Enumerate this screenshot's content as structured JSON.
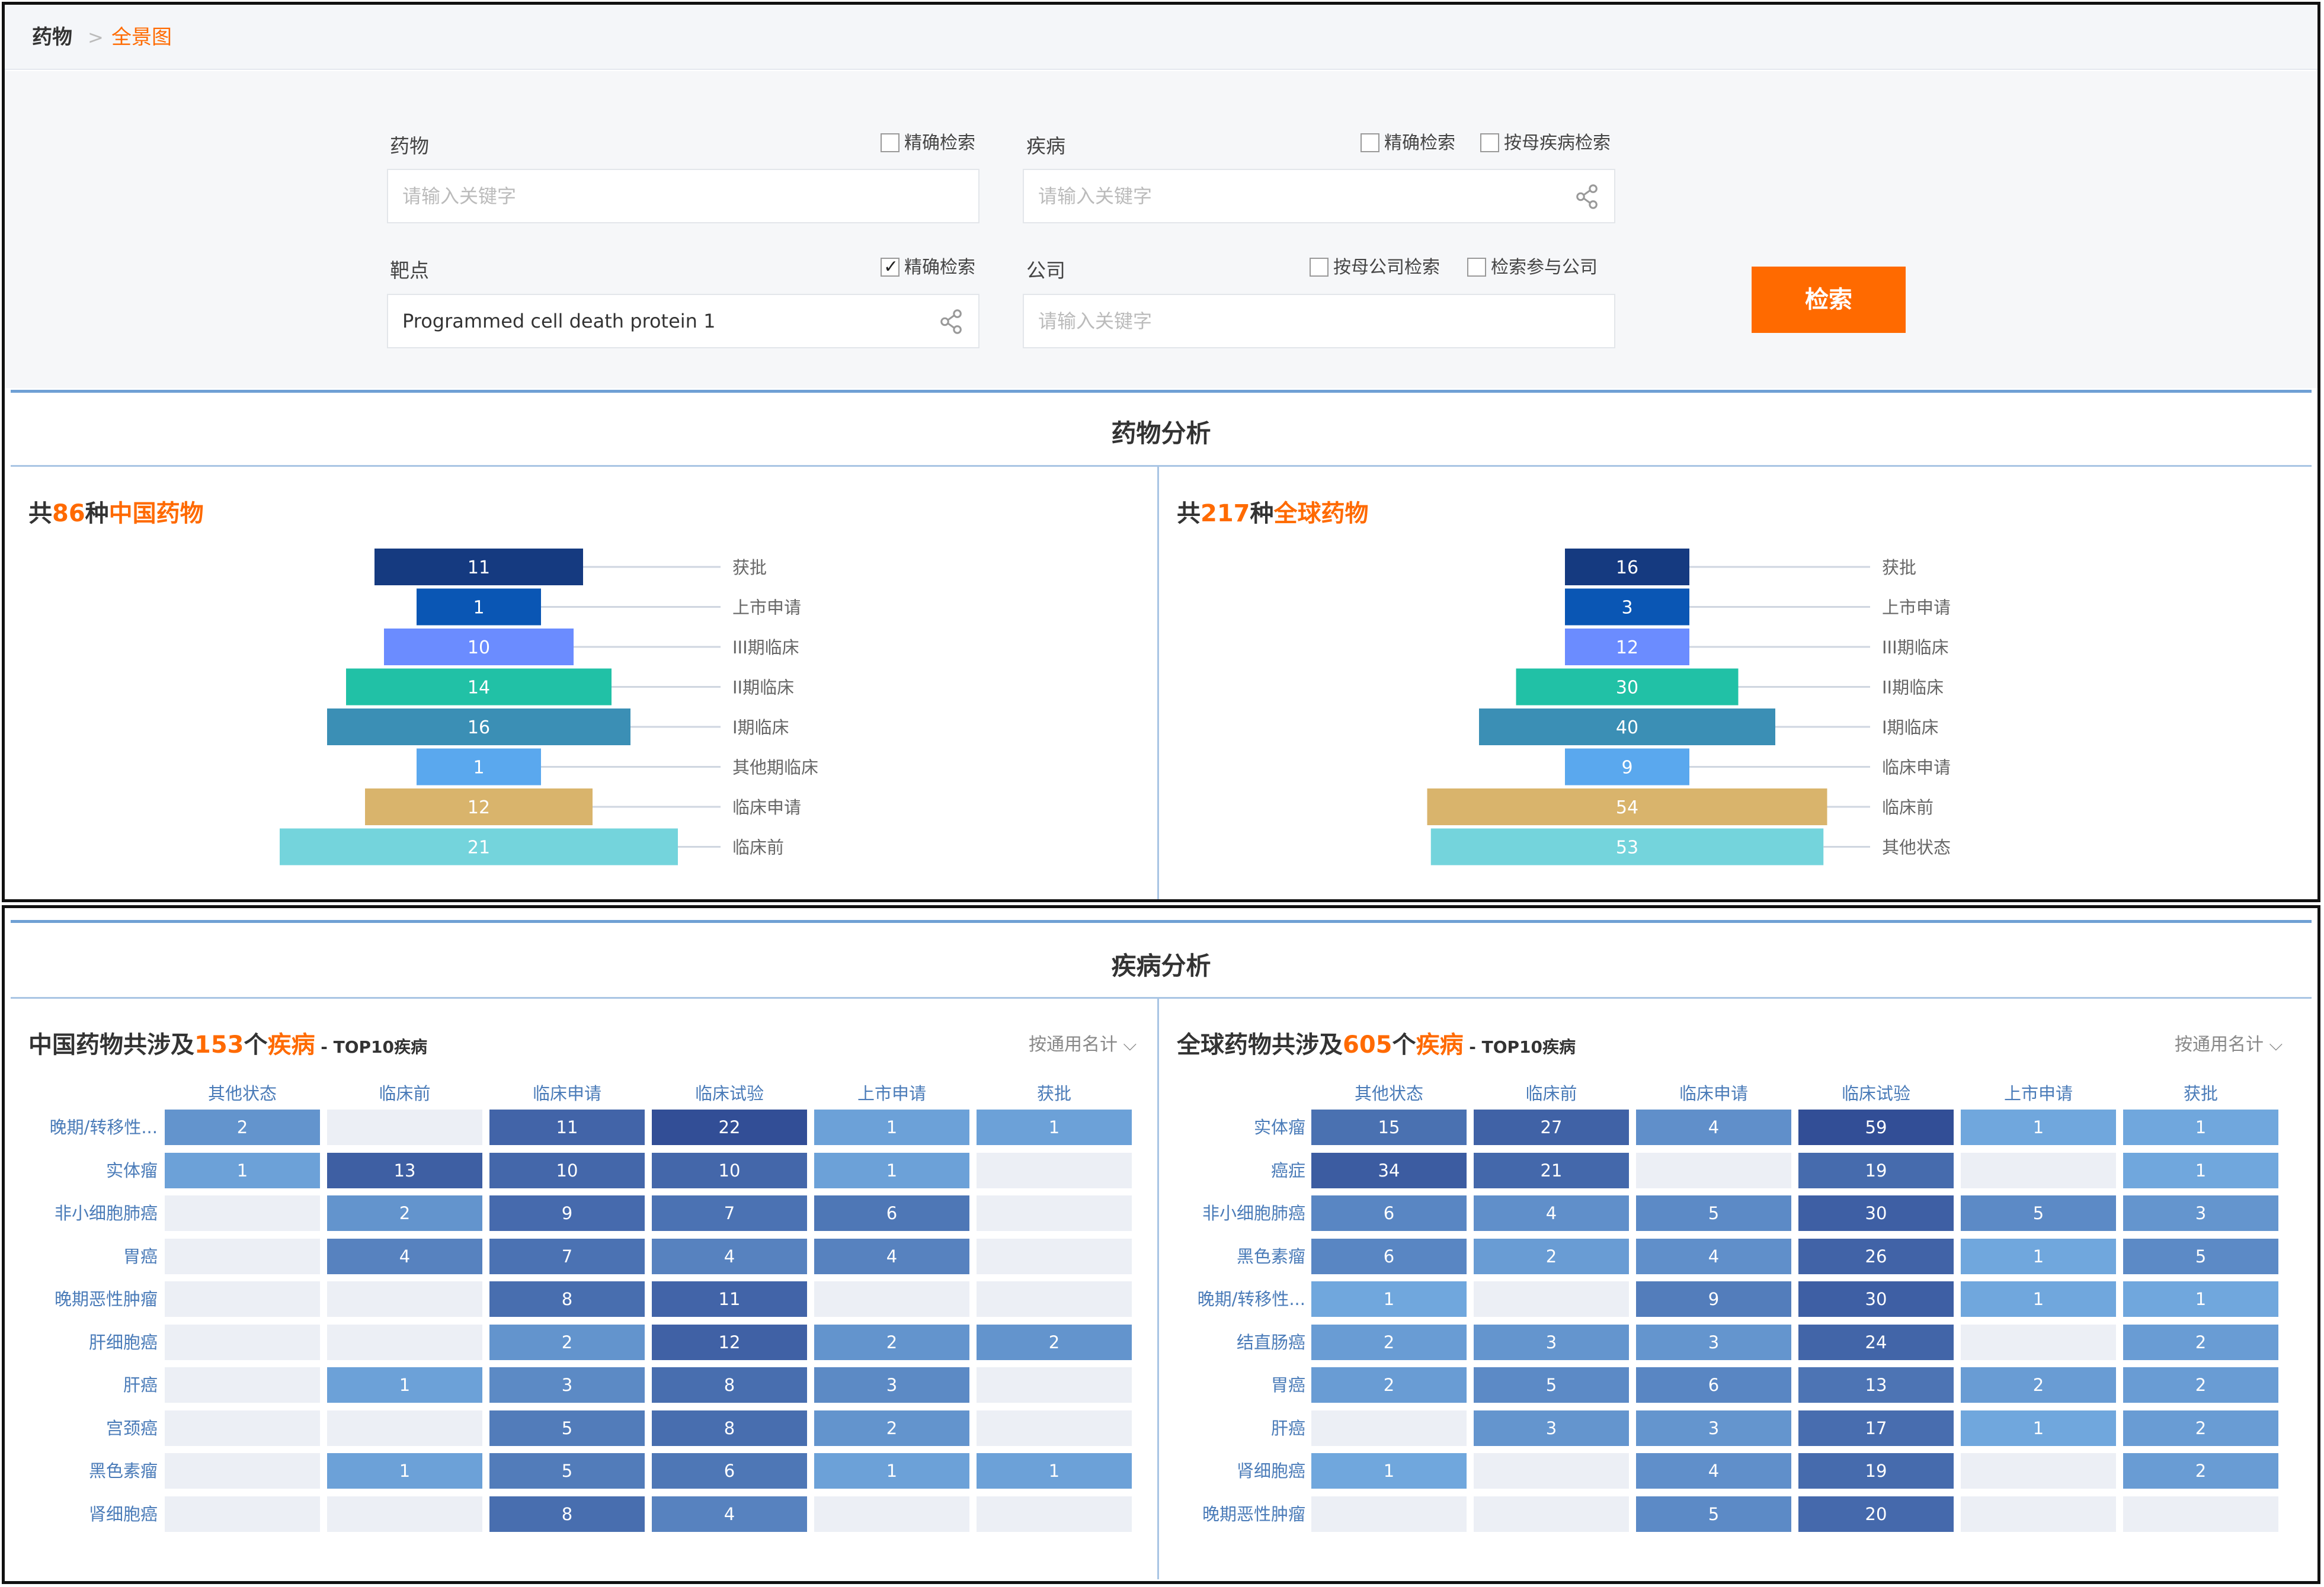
{
  "breadcrumb": {
    "root": "药物",
    "sep": ">",
    "current": "全景图"
  },
  "search": {
    "drug_label": "药物",
    "drug_placeholder": "请输入关键字",
    "drug_exact": "精确检索",
    "disease_label": "疾病",
    "disease_placeholder": "请输入关键字",
    "disease_exact": "精确检索",
    "disease_parent": "按母疾病检索",
    "target_label": "靶点",
    "target_value": "Programmed cell death protein 1",
    "target_exact": "精确检索",
    "company_label": "公司",
    "company_placeholder": "请输入关键字",
    "company_parent": "按母公司检索",
    "company_part": "检索参与公司",
    "button": "检索"
  },
  "drug_analysis": {
    "title": "药物分析",
    "china": {
      "prefix": "共",
      "count": "86",
      "mid": "种",
      "suffix": "中国药物"
    },
    "global": {
      "prefix": "共",
      "count": "217",
      "mid": "种",
      "suffix": "全球药物"
    }
  },
  "disease_analysis": {
    "title": "疾病分析",
    "china": {
      "prefix": "中国药物共涉及",
      "count": "153",
      "mid": "个",
      "org": "疾病",
      "suffix": " - TOP10疾病",
      "sort": "按通用名计"
    },
    "global": {
      "prefix": "全球药物共涉及",
      "count": "605",
      "mid": "个",
      "org": "疾病",
      "suffix": " - TOP10疾病",
      "sort": "按通用名计"
    }
  },
  "chart_data": [
    {
      "type": "funnel",
      "title": "共86种中国药物",
      "categories": [
        "获批",
        "上市申请",
        "III期临床",
        "II期临床",
        "I期临床",
        "其他期临床",
        "临床申请",
        "临床前"
      ],
      "values": [
        11,
        1,
        10,
        14,
        16,
        1,
        12,
        21
      ],
      "colors": [
        "#153a80",
        "#0a56b4",
        "#6b8cff",
        "#21c1a6",
        "#3b8fb5",
        "#5aa8ee",
        "#d9b46c",
        "#74d4dc"
      ]
    },
    {
      "type": "funnel",
      "title": "共217种全球药物",
      "categories": [
        "获批",
        "上市申请",
        "III期临床",
        "II期临床",
        "I期临床",
        "临床申请",
        "临床前",
        "其他状态"
      ],
      "values": [
        16,
        3,
        12,
        30,
        40,
        9,
        54,
        53
      ],
      "colors": [
        "#153a80",
        "#0a56b4",
        "#6b8cff",
        "#21c1a6",
        "#3b8fb5",
        "#5aa8ee",
        "#d9b46c",
        "#74d4dc"
      ]
    },
    {
      "type": "heatmap",
      "title": "中国药物共涉及153个疾病 - TOP10疾病",
      "columns": [
        "其他状态",
        "临床前",
        "临床申请",
        "临床试验",
        "上市申请",
        "获批"
      ],
      "rows": [
        "晚期/转移性...",
        "实体瘤",
        "非小细胞肺癌",
        "胃癌",
        "晚期恶性肿瘤",
        "肝细胞癌",
        "肝癌",
        "宫颈癌",
        "黑色素瘤",
        "肾细胞癌"
      ],
      "values": [
        [
          2,
          null,
          11,
          22,
          1,
          1
        ],
        [
          1,
          13,
          10,
          10,
          1,
          null
        ],
        [
          null,
          2,
          9,
          7,
          6,
          null
        ],
        [
          null,
          4,
          7,
          4,
          4,
          null
        ],
        [
          null,
          null,
          8,
          11,
          null,
          null
        ],
        [
          null,
          null,
          2,
          12,
          2,
          2
        ],
        [
          null,
          1,
          3,
          8,
          3,
          null
        ],
        [
          null,
          null,
          5,
          8,
          2,
          null
        ],
        [
          null,
          1,
          5,
          6,
          1,
          1
        ],
        [
          null,
          null,
          8,
          4,
          null,
          null
        ]
      ]
    },
    {
      "type": "heatmap",
      "title": "全球药物共涉及605个疾病 - TOP10疾病",
      "columns": [
        "其他状态",
        "临床前",
        "临床申请",
        "临床试验",
        "上市申请",
        "获批"
      ],
      "rows": [
        "实体瘤",
        "癌症",
        "非小细胞肺癌",
        "黑色素瘤",
        "晚期/转移性...",
        "结直肠癌",
        "胃癌",
        "肝癌",
        "肾细胞癌",
        "晚期恶性肿瘤"
      ],
      "values": [
        [
          15,
          27,
          4,
          59,
          1,
          1
        ],
        [
          34,
          21,
          null,
          19,
          null,
          1
        ],
        [
          6,
          4,
          5,
          30,
          5,
          3
        ],
        [
          6,
          2,
          4,
          26,
          1,
          5
        ],
        [
          1,
          null,
          9,
          30,
          1,
          1
        ],
        [
          2,
          3,
          3,
          24,
          null,
          2
        ],
        [
          2,
          5,
          6,
          13,
          2,
          2
        ],
        [
          null,
          3,
          3,
          17,
          1,
          2
        ],
        [
          1,
          null,
          4,
          19,
          null,
          2
        ],
        [
          null,
          null,
          5,
          20,
          null,
          null
        ]
      ]
    }
  ]
}
